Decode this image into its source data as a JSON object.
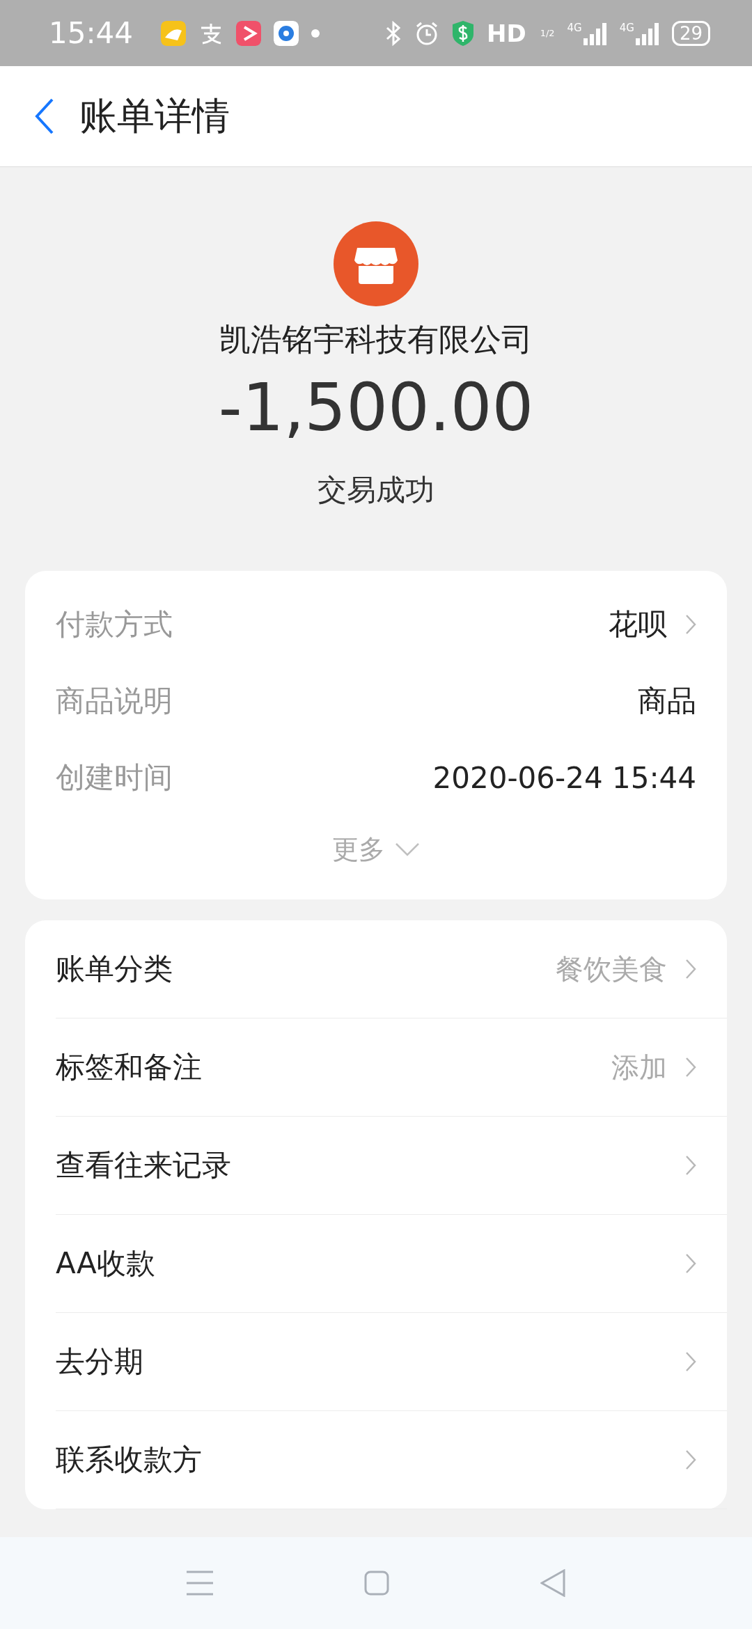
{
  "status_bar": {
    "time": "15:44",
    "hd": "HD",
    "hd_sub": "1/2",
    "networks": [
      "4G",
      "4G"
    ],
    "battery": "29"
  },
  "header": {
    "title": "账单详情"
  },
  "merchant": {
    "name": "凯浩铭宇科技有限公司",
    "amount": "-1,500.00",
    "status": "交易成功"
  },
  "details": [
    {
      "label": "付款方式",
      "value": "花呗",
      "chevron": true
    },
    {
      "label": "商品说明",
      "value": "商品",
      "chevron": false
    },
    {
      "label": "创建时间",
      "value": "2020-06-24 15:44",
      "chevron": false
    }
  ],
  "more": "更多",
  "actions": [
    {
      "label": "账单分类",
      "value": "餐饮美食"
    },
    {
      "label": "标签和备注",
      "value": "添加"
    },
    {
      "label": "查看往来记录"
    },
    {
      "label": "AA收款"
    },
    {
      "label": "去分期"
    },
    {
      "label": "联系收款方"
    }
  ]
}
